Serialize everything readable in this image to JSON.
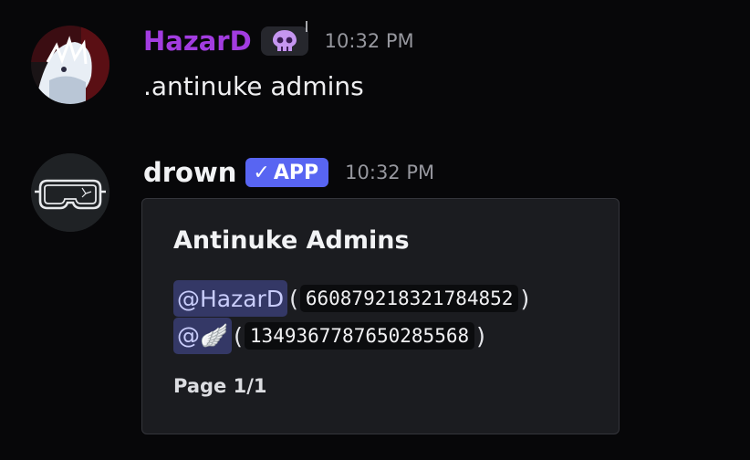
{
  "messages": [
    {
      "username": "HazarD",
      "badge_icon": "skull-icon",
      "timestamp": "10:32 PM",
      "content": ".antinuke admins"
    },
    {
      "username": "drown",
      "app_tag": {
        "check": "✓",
        "label": "APP"
      },
      "timestamp": "10:32 PM",
      "embed": {
        "title": "Antinuke Admins",
        "rows": [
          {
            "mention": "@HazarD",
            "id": "660879218321784852"
          },
          {
            "mention": "@🪽",
            "id": "1349367787650285568"
          }
        ],
        "footer": "Page 1/1"
      }
    }
  ],
  "colors": {
    "background": "#070709",
    "username_hazard": "#a23ce0",
    "app_tag": "#5865f2",
    "mention_bg": "#343866",
    "embed_bg": "#1b1c20"
  }
}
